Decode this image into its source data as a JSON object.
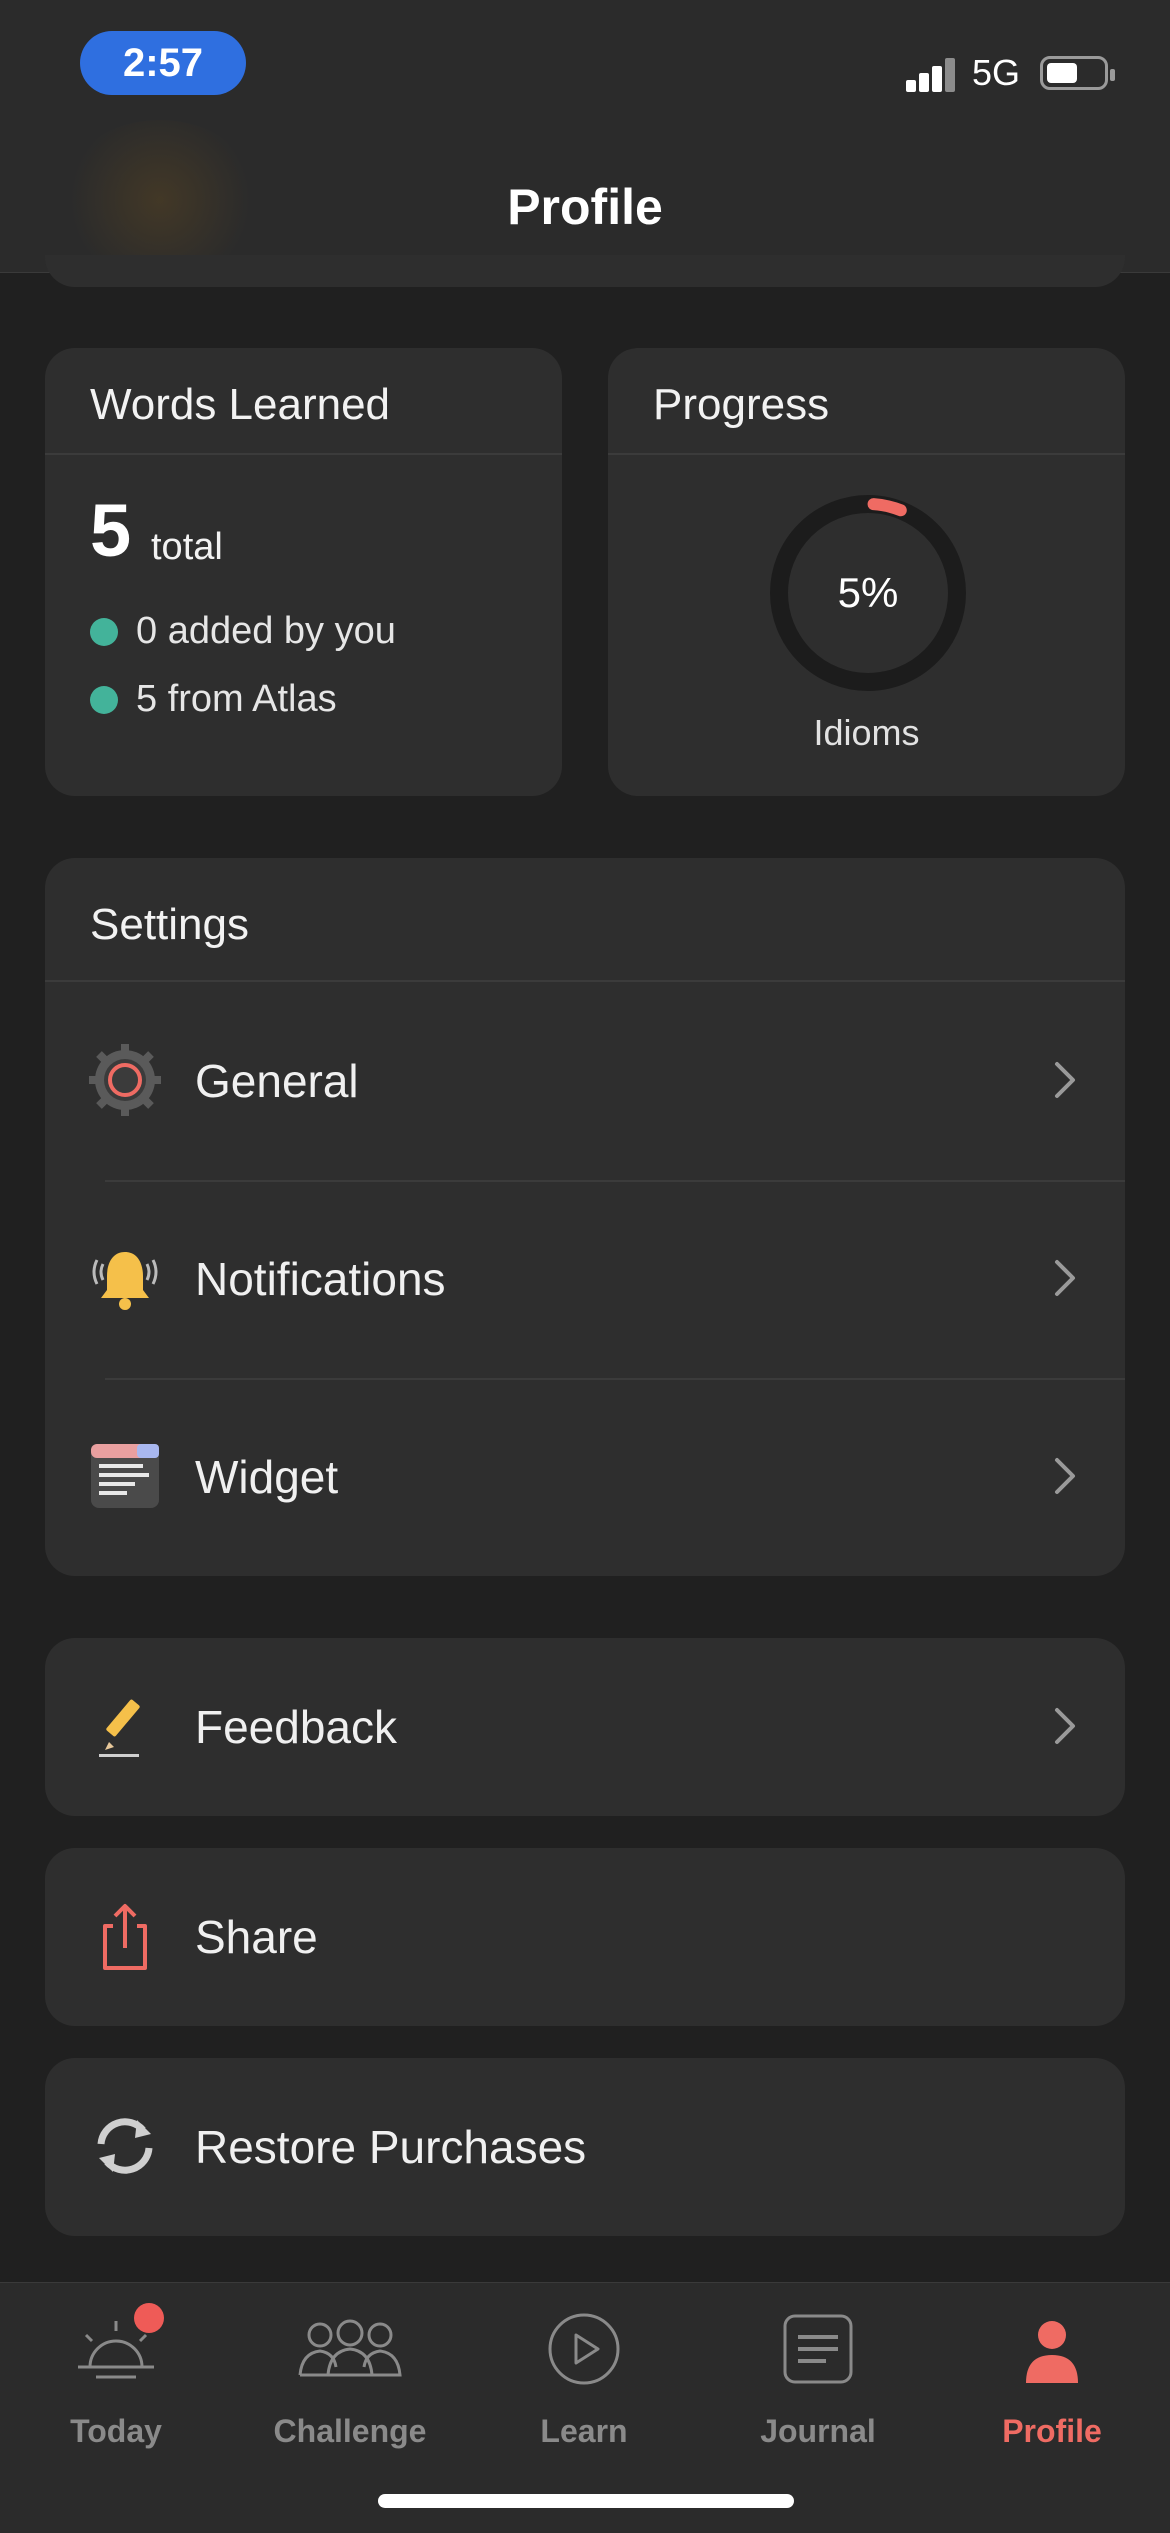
{
  "status": {
    "time": "2:57",
    "network": "5G"
  },
  "header": {
    "title": "Profile"
  },
  "words_learned": {
    "title": "Words Learned",
    "total": "5",
    "total_label": "total",
    "added_by_you": "0 added by you",
    "from_atlas": "5 from Atlas",
    "dot_color": "#43b39a"
  },
  "progress": {
    "title": "Progress",
    "percent_text": "5%",
    "percent_value": 0.05,
    "label": "Idioms",
    "ring_color": "#ef6b63"
  },
  "settings": {
    "title": "Settings",
    "items": [
      {
        "label": "General",
        "icon": "gear-icon"
      },
      {
        "label": "Notifications",
        "icon": "bell-icon"
      },
      {
        "label": "Widget",
        "icon": "widget-icon"
      }
    ]
  },
  "actions": {
    "feedback": "Feedback",
    "share": "Share",
    "restore": "Restore Purchases"
  },
  "tabs": [
    {
      "label": "Today",
      "icon": "sunrise-icon",
      "badge": true
    },
    {
      "label": "Challenge",
      "icon": "people-icon"
    },
    {
      "label": "Learn",
      "icon": "play-icon"
    },
    {
      "label": "Journal",
      "icon": "journal-icon"
    },
    {
      "label": "Profile",
      "icon": "person-icon",
      "active": true
    }
  ],
  "accent_color": "#ef6b63"
}
